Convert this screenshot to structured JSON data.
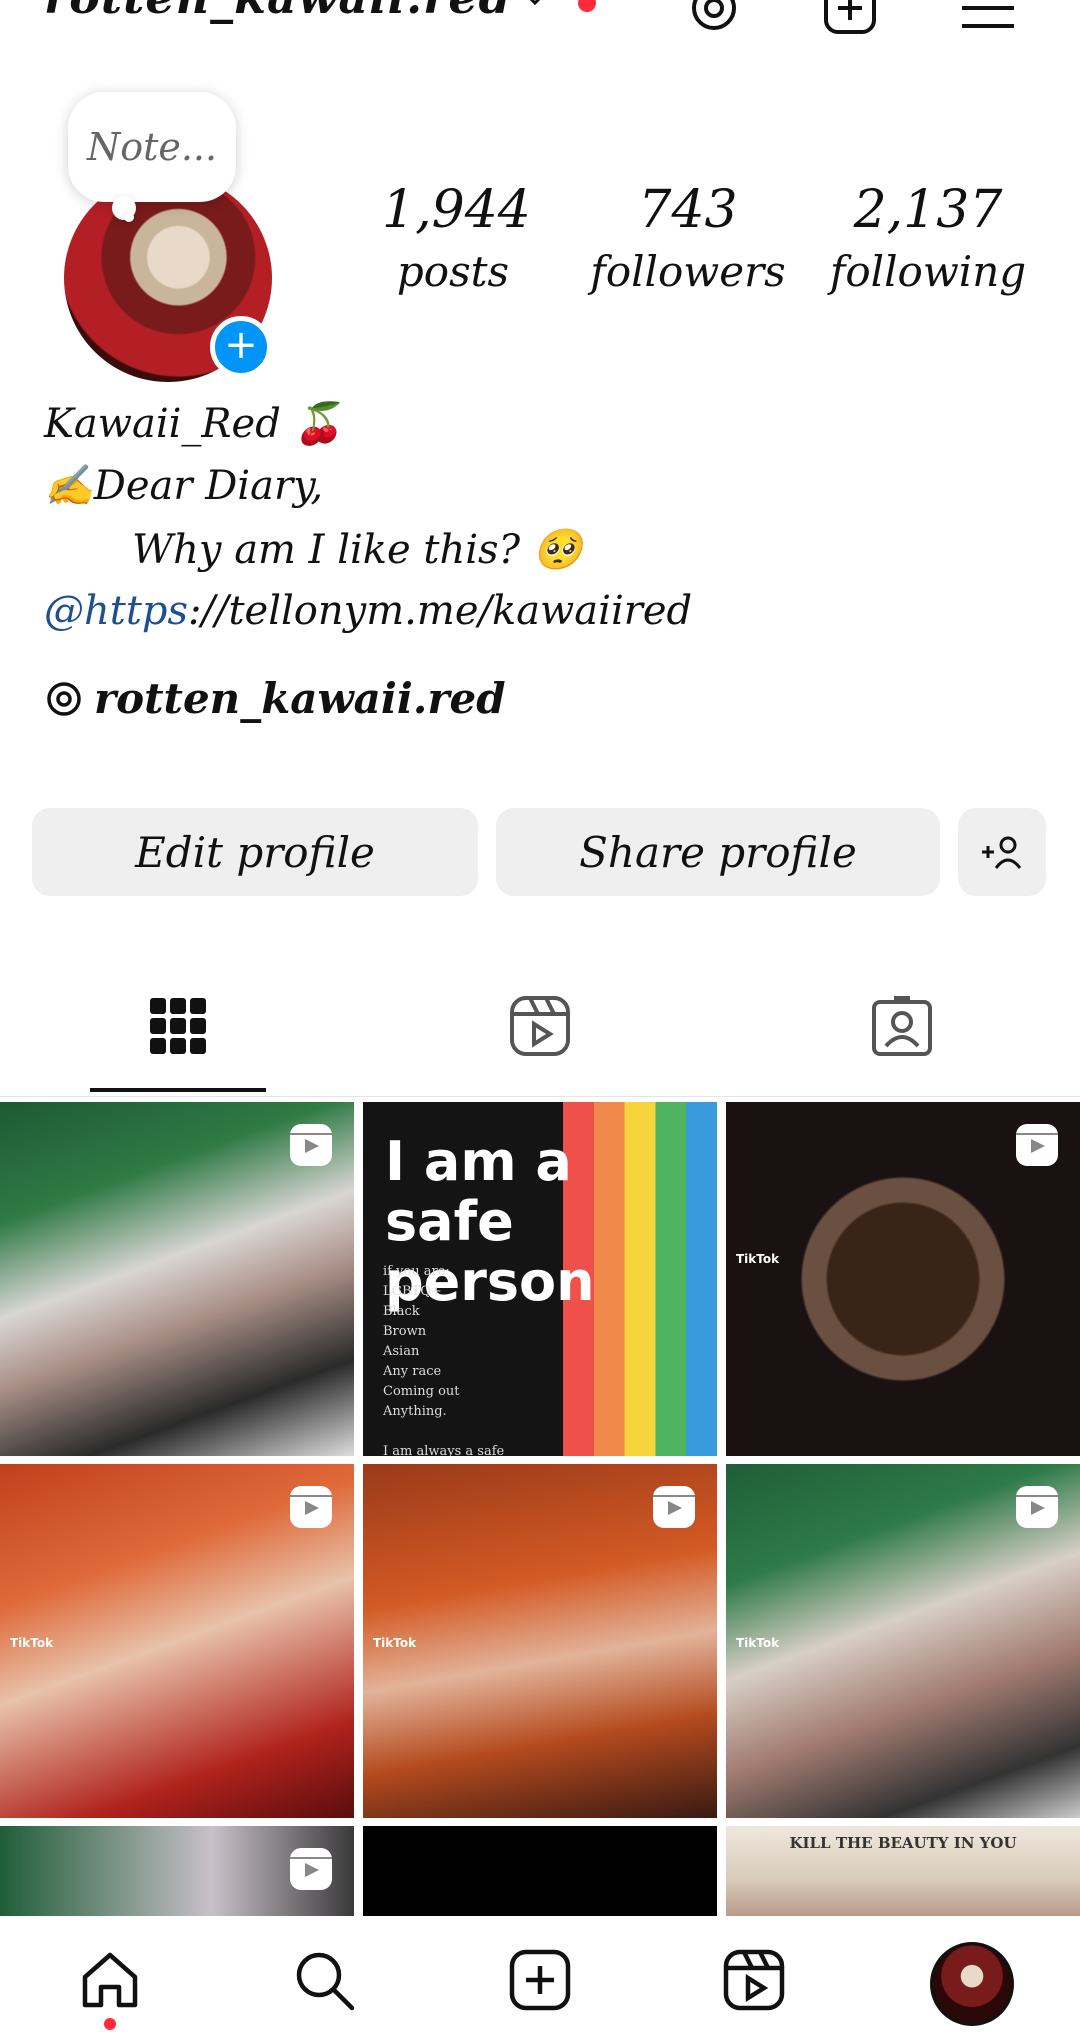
{
  "header": {
    "username": "rotten_kawaii.red"
  },
  "note": {
    "placeholder": "Note..."
  },
  "stats": {
    "posts": {
      "count": "1,944",
      "label": "posts"
    },
    "followers": {
      "count": "743",
      "label": "followers"
    },
    "following": {
      "count": "2,137",
      "label": "following"
    }
  },
  "bio": {
    "name": "Kawaii_Red 🍒",
    "line1": "✍️Dear Diary,",
    "line2": "Why am I like this? 🥺",
    "link_prefix": "@https",
    "link_rest": "://tellonym.me/kawaiired",
    "threads_handle": "rotten_kawaii.red"
  },
  "buttons": {
    "edit": "Edit profile",
    "share": "Share profile"
  },
  "tiles": {
    "safe_title": "I am a\nsafe\nperson",
    "safe_body": "if you are:\nLGBTQ+\nBlack\nBrown\nAsian\nAny race\nComing out\nAnything.\n\nI am always a safe\nperson and will hold",
    "tiktok_label": "TikTok",
    "kill_title": "KILL THE BEAUTY IN YOU"
  },
  "icons": {
    "chevron": "chevron-down-icon",
    "threads": "threads-icon",
    "create": "plus-square-icon",
    "menu": "hamburger-menu-icon",
    "add_person": "add-person-icon",
    "grid": "grid-icon",
    "reels": "reels-icon",
    "tagged": "tagged-icon",
    "home": "home-icon",
    "search": "search-icon"
  },
  "colors": {
    "accent_blue": "#0095f6",
    "notification_red": "#ff2a3a",
    "button_bg": "#efefef"
  }
}
